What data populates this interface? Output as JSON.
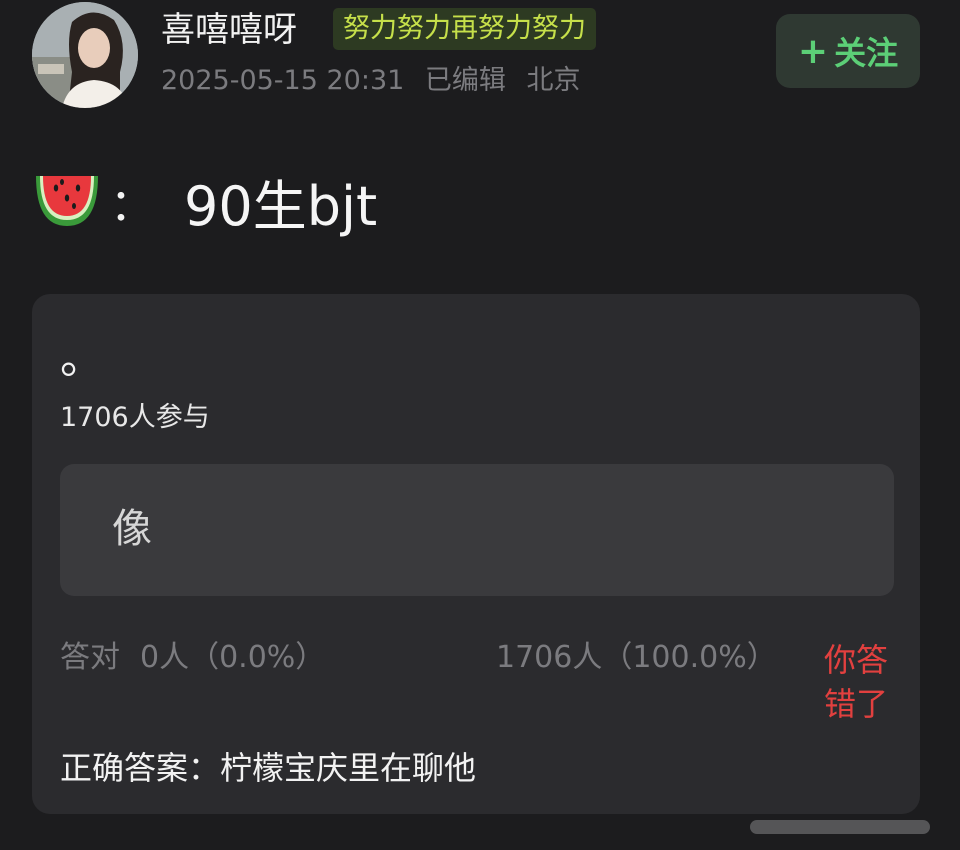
{
  "header": {
    "username": "喜嘻嘻呀",
    "badge": "努力努力再努力努力",
    "date": "2025-05-15 20:31",
    "edited": "已编辑",
    "location": "北京",
    "follow_label": "关注",
    "follow_icon": "plus-icon",
    "accent_color": "#5ccf77"
  },
  "post": {
    "emoji": "watermelon-icon",
    "colon": "：",
    "text": "90生bjt"
  },
  "quiz": {
    "title": "。",
    "participants": "1706人参与",
    "option_label": "像",
    "correct_label": "答对",
    "correct_count": "0人（0.0%）",
    "wrong_count": "1706人（100.0%）",
    "wrong_flag": "你答错了",
    "answer": "正确答案：柠檬宝庆里在聊他",
    "wrong_color": "#e2403f"
  }
}
